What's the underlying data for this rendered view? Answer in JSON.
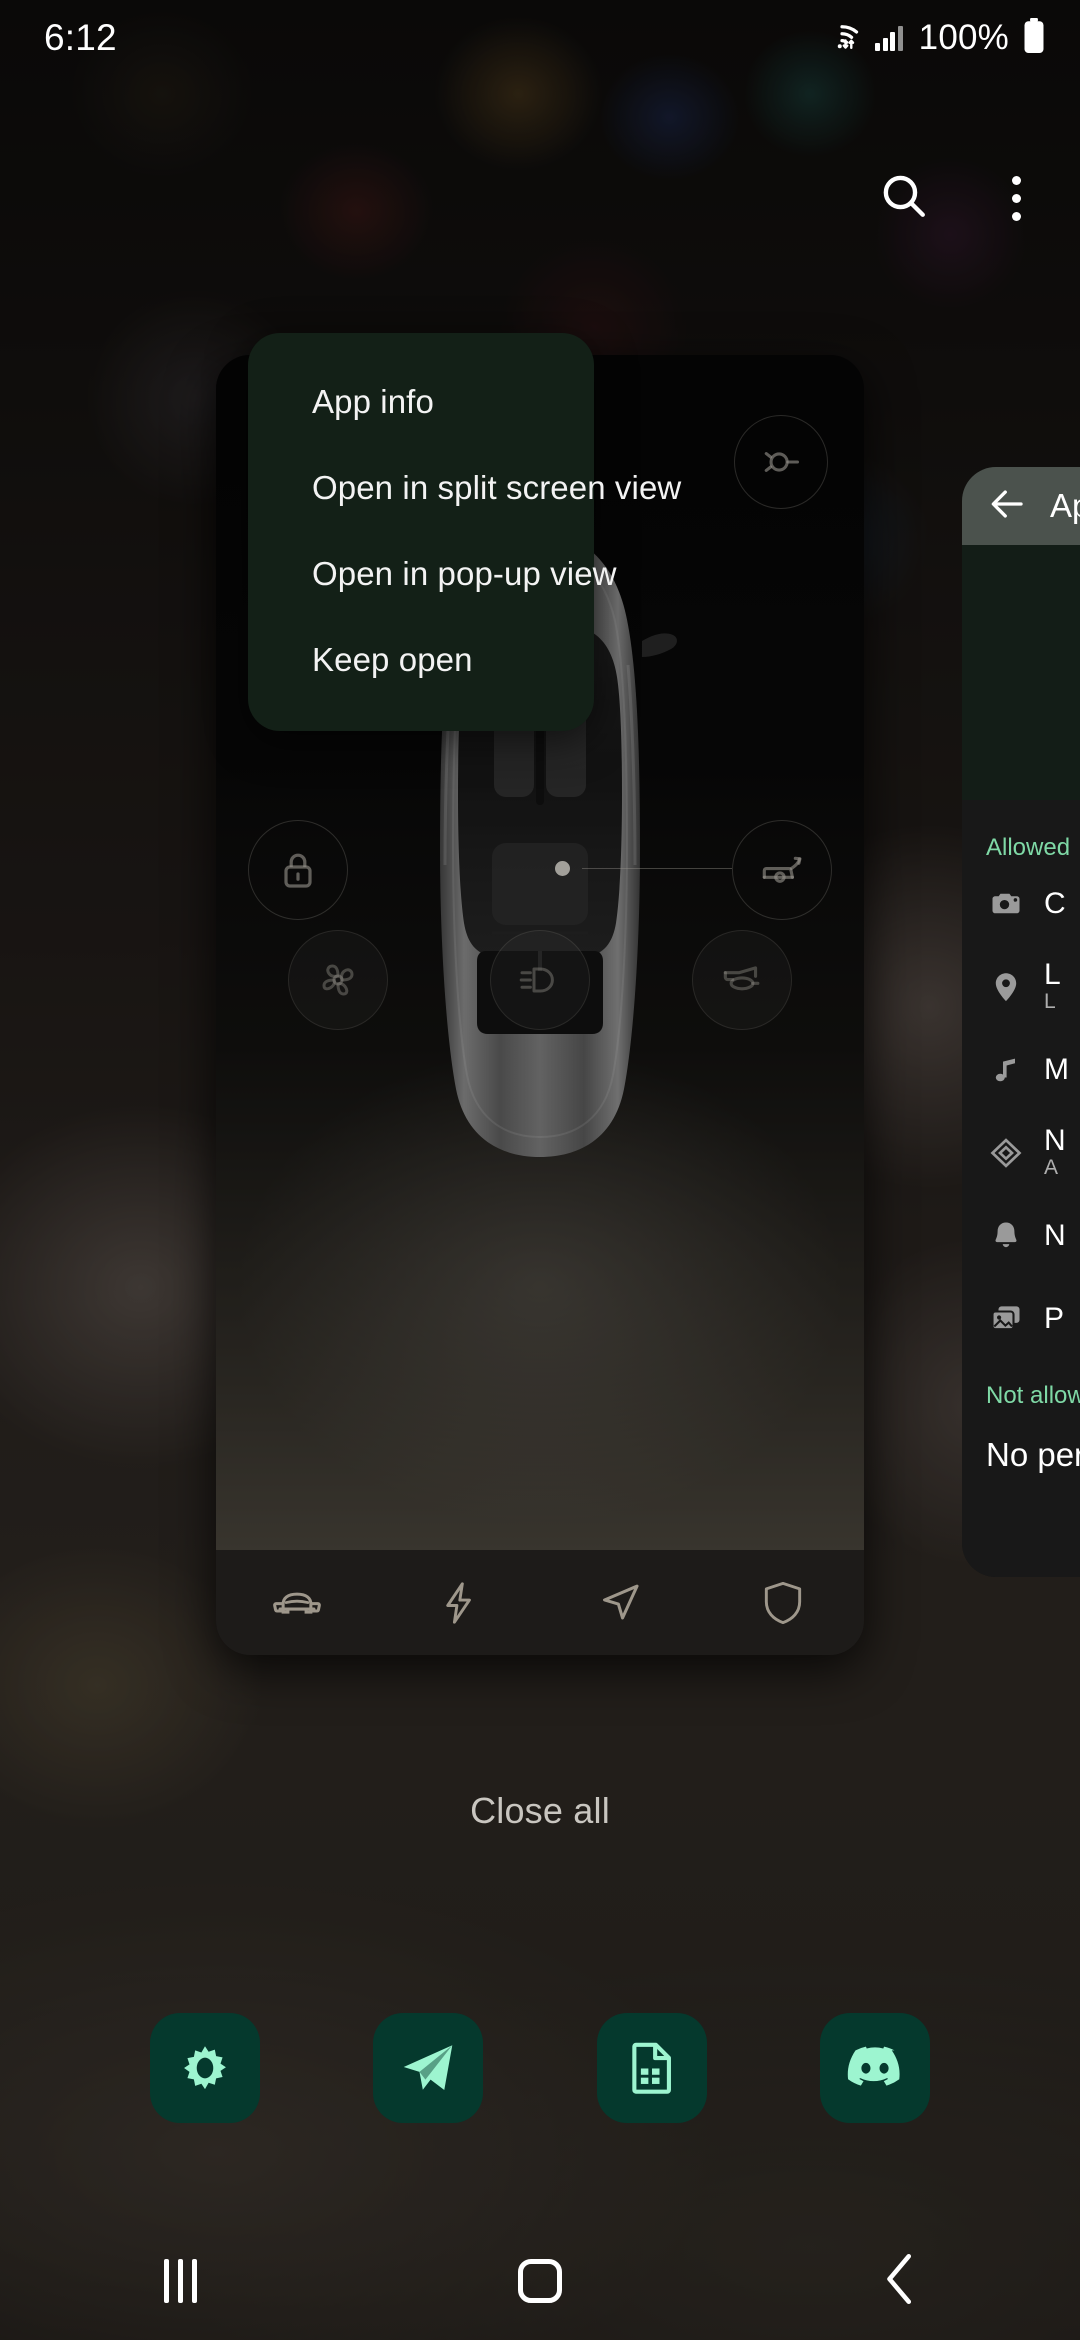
{
  "status_bar": {
    "time": "6:12",
    "battery_percent": "100%",
    "icons": [
      "wifi-icon",
      "signal-icon",
      "battery-icon"
    ]
  },
  "recents_header": {
    "search_icon": "search-icon",
    "more_icon": "kebab-menu-icon"
  },
  "context_menu": {
    "items": [
      {
        "label": "App info"
      },
      {
        "label": "Open in split screen view"
      },
      {
        "label": "Open in pop-up view"
      },
      {
        "label": "Keep open"
      }
    ]
  },
  "app_card": {
    "name": "car-control-app",
    "quick_actions": [
      {
        "name": "charge-port-button",
        "icon": "charge-plug-icon"
      },
      {
        "name": "headlight-flash-button",
        "icon": "headlight-icon"
      },
      {
        "name": "lock-button",
        "icon": "lock-icon"
      },
      {
        "name": "trunk-button",
        "icon": "trunk-open-icon"
      },
      {
        "name": "climate-button",
        "icon": "fan-icon"
      },
      {
        "name": "lights-button",
        "icon": "low-beam-icon"
      },
      {
        "name": "horn-button",
        "icon": "horn-icon"
      }
    ],
    "bottom_nav": [
      {
        "name": "tab-car",
        "icon": "car-front-icon"
      },
      {
        "name": "tab-charging",
        "icon": "lightning-bolt-icon"
      },
      {
        "name": "tab-location",
        "icon": "navigation-arrow-icon"
      },
      {
        "name": "tab-security",
        "icon": "shield-icon"
      }
    ]
  },
  "right_card": {
    "back_icon": "back-arrow-icon",
    "title": "App",
    "sections": {
      "allowed_label": "Allowed",
      "not_allowed_label": "Not allowed",
      "no_permissions_label": "No per"
    },
    "permissions": [
      {
        "icon": "camera-icon",
        "label": "C",
        "sub": ""
      },
      {
        "icon": "location-pin-icon",
        "label": "L",
        "sub": "L"
      },
      {
        "icon": "music-note-icon",
        "label": "M",
        "sub": ""
      },
      {
        "icon": "nearby-devices-icon",
        "label": "N",
        "sub": "A"
      },
      {
        "icon": "bell-icon",
        "label": "N",
        "sub": ""
      },
      {
        "icon": "photos-icon",
        "label": "P",
        "sub": ""
      }
    ]
  },
  "recents": {
    "close_all_label": "Close all"
  },
  "dock": {
    "items": [
      {
        "name": "dock-settings",
        "icon": "gear-icon"
      },
      {
        "name": "dock-telegram",
        "icon": "paper-plane-icon"
      },
      {
        "name": "dock-sheets",
        "icon": "spreadsheet-document-icon"
      },
      {
        "name": "dock-discord",
        "icon": "discord-icon"
      }
    ]
  },
  "navigation_bar": {
    "recents": "recents-icon",
    "home": "home-icon",
    "back": "back-chevron-icon"
  },
  "colors": {
    "menu_background": "#132017",
    "dock_icon_background": "#05392d",
    "dock_icon_foreground": "#9df5d0",
    "accent_green": "#7fd9a6",
    "app_bar": "#4b524d"
  }
}
